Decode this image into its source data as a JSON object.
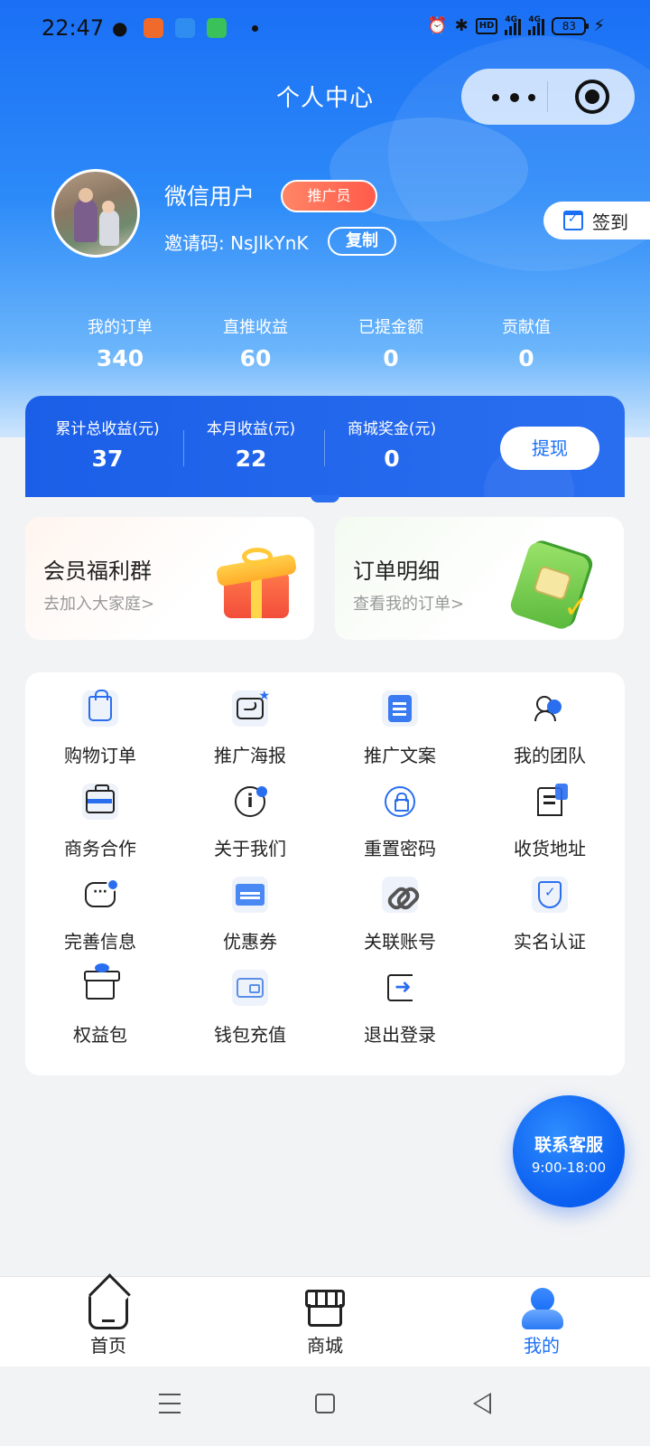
{
  "status_bar": {
    "time": "22:47",
    "hd_label": "HD",
    "network": "4G",
    "network2": "4G",
    "battery": "83"
  },
  "header": {
    "title": "个人中心"
  },
  "profile": {
    "username": "微信用户",
    "role_badge": "推广员",
    "invite_label": "邀请码: NsJlkYnK",
    "copy_label": "复制",
    "signin_label": "签到"
  },
  "stats": [
    {
      "label": "我的订单",
      "value": "340"
    },
    {
      "label": "直推收益",
      "value": "60"
    },
    {
      "label": "已提金额",
      "value": "0"
    },
    {
      "label": "贡献值",
      "value": "0"
    }
  ],
  "earnings": [
    {
      "label": "累计总收益(元)",
      "value": "37"
    },
    {
      "label": "本月收益(元)",
      "value": "22"
    },
    {
      "label": "商城奖金(元)",
      "value": "0"
    }
  ],
  "withdraw_label": "提现",
  "promo_cards": [
    {
      "title": "会员福利群",
      "subtitle": "去加入大家庭>"
    },
    {
      "title": "订单明细",
      "subtitle": "查看我的订单>"
    }
  ],
  "menu_items": [
    {
      "label": "购物订单",
      "icon": "shopping-bag-icon"
    },
    {
      "label": "推广海报",
      "icon": "poster-envelope-icon"
    },
    {
      "label": "推广文案",
      "icon": "document-icon"
    },
    {
      "label": "我的团队",
      "icon": "team-icon"
    },
    {
      "label": "商务合作",
      "icon": "briefcase-icon"
    },
    {
      "label": "关于我们",
      "icon": "info-icon"
    },
    {
      "label": "重置密码",
      "icon": "lock-reset-icon"
    },
    {
      "label": "收货地址",
      "icon": "receipt-icon"
    },
    {
      "label": "完善信息",
      "icon": "chat-icon"
    },
    {
      "label": "优惠券",
      "icon": "coupon-icon"
    },
    {
      "label": "关联账号",
      "icon": "link-icon"
    },
    {
      "label": "实名认证",
      "icon": "shield-check-icon"
    },
    {
      "label": "权益包",
      "icon": "gift-box-icon"
    },
    {
      "label": "钱包充值",
      "icon": "wallet-icon"
    },
    {
      "label": "退出登录",
      "icon": "logout-icon"
    }
  ],
  "service": {
    "title": "联系客服",
    "hours": "9:00-18:00"
  },
  "tabbar": [
    {
      "label": "首页",
      "icon": "home-icon"
    },
    {
      "label": "商城",
      "icon": "shop-icon"
    },
    {
      "label": "我的",
      "icon": "profile-icon",
      "active": true
    }
  ],
  "colors": {
    "primary": "#1a6ff5",
    "badge": "#ff5b4a",
    "background": "#f2f3f5"
  }
}
